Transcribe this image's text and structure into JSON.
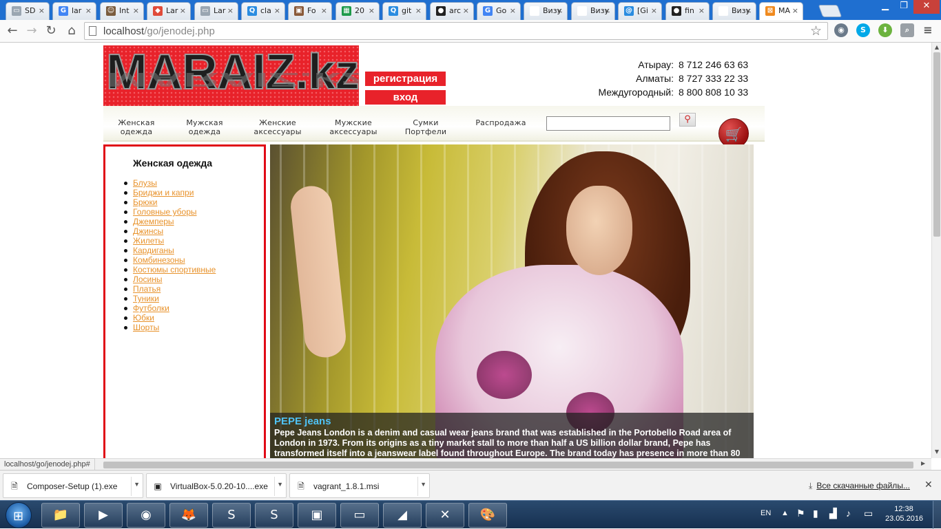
{
  "browser": {
    "tabs": [
      {
        "label": "SD",
        "color": "#9aa6b2",
        "glyph": "▭"
      },
      {
        "label": "lar",
        "color": "#4285f4",
        "glyph": "G"
      },
      {
        "label": "Int",
        "color": "#7a5c3e",
        "glyph": "☺"
      },
      {
        "label": "Lar",
        "color": "#e04b3a",
        "glyph": "◆"
      },
      {
        "label": "Lar",
        "color": "#9aa6b2",
        "glyph": "▭"
      },
      {
        "label": "cla",
        "color": "#2a8ce0",
        "glyph": "Q"
      },
      {
        "label": "Fo",
        "color": "#8a5a3a",
        "glyph": "▣"
      },
      {
        "label": "20",
        "color": "#1e9a4a",
        "glyph": "▦"
      },
      {
        "label": "git",
        "color": "#2a8ce0",
        "glyph": "Q"
      },
      {
        "label": "arc",
        "color": "#222222",
        "glyph": "●"
      },
      {
        "label": "Go",
        "color": "#4285f4",
        "glyph": "G"
      },
      {
        "label": "Визуа",
        "color": "#ffffff",
        "glyph": ""
      },
      {
        "label": "Визуа",
        "color": "#ffffff",
        "glyph": ""
      },
      {
        "label": "[Gi",
        "color": "#2a8ce0",
        "glyph": "@"
      },
      {
        "label": "fin",
        "color": "#222222",
        "glyph": "●"
      },
      {
        "label": "Визуа",
        "color": "#ffffff",
        "glyph": ""
      },
      {
        "label": "MA",
        "color": "#f08a1e",
        "glyph": "⊠",
        "active": true
      }
    ],
    "url_host": "localhost",
    "url_path": "/go/jenodej.php",
    "status_text": "localhost/go/jenodej.php#"
  },
  "site": {
    "logo_text": "MARAIZ.kz",
    "register_label": "регистрация",
    "login_label": "вход",
    "phones": [
      {
        "city": "Атырау:",
        "number": "8 712 246 63 63"
      },
      {
        "city": "Алматы:",
        "number": "8 727 333 22 33"
      },
      {
        "city": "Междугородный:",
        "number": "8 800 808 10 33"
      }
    ],
    "menu": [
      {
        "line1": "Женская",
        "line2": "одежда"
      },
      {
        "line1": "Мужская",
        "line2": "одежда"
      },
      {
        "line1": "Женские",
        "line2": "аксессуары"
      },
      {
        "line1": "Мужские",
        "line2": "аксессуары"
      },
      {
        "line1": "Сумки",
        "line2": "Портфели"
      },
      {
        "line1": "Распродажа",
        "line2": ""
      }
    ],
    "search_value": "",
    "sidebar_title": "Женская одежда",
    "categories": [
      "Блузы",
      "Бриджи и капри",
      "Брюки",
      "Головные уборы",
      "Джемперы",
      "Джинсы",
      "Жилеты",
      "Кардиганы",
      "Комбинезоны",
      "Костюмы спортивные",
      "Лосины",
      "Платья",
      "Туники",
      "Футболки",
      "Юбки",
      "Шорты"
    ],
    "banner": {
      "title": "PEPE jeans",
      "text": "Pepe Jeans London is a denim and casual wear jeans brand that was established in the Portobello Road area of London in 1973. From its origins as a tiny market stall to more than half a US billion dollar brand, Pepe has transformed itself into a jeanswear label found throughout Europe. The brand today has presence in more than 80"
    }
  },
  "downloads": {
    "items": [
      "Composer-Setup (1).exe",
      "VirtualBox-5.0.20-10....exe",
      "vagrant_1.8.1.msi"
    ],
    "all_label": "Все скачанные файлы..."
  },
  "taskbar": {
    "lang": "EN",
    "time": "12:38",
    "date": "23.05.2016"
  }
}
